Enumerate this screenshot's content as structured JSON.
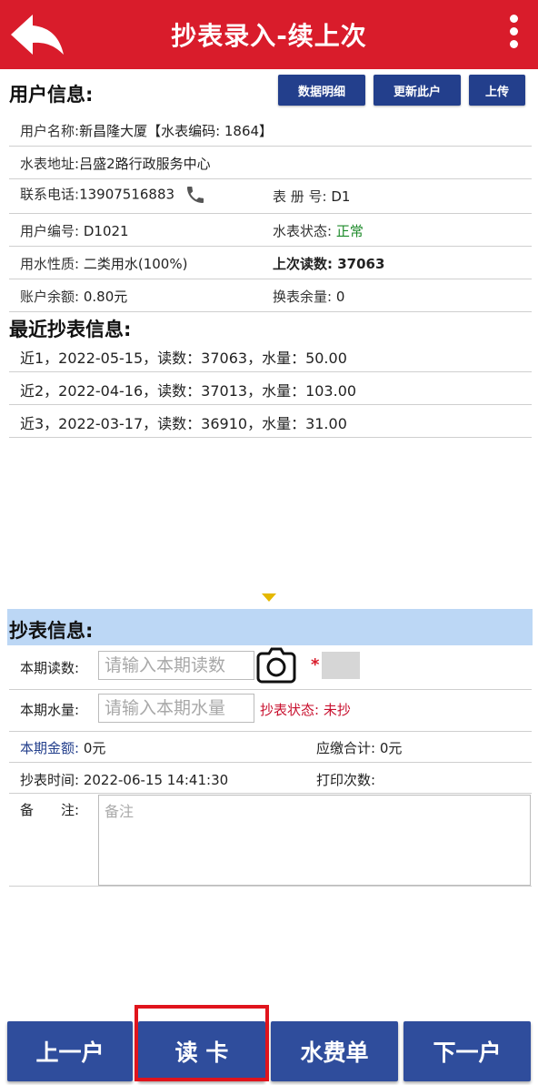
{
  "header": {
    "title": "抄表录入-续上次"
  },
  "user_section": {
    "title": "用户信息:",
    "buttons": {
      "detail": "数据明细",
      "update": "更新此户",
      "upload": "上传"
    },
    "name_label": "用户名称:",
    "name_value": "新昌隆大厦【水表编码: 1864】",
    "address_label": "水表地址:",
    "address_value": "吕盛2路行政服务中心",
    "phone_label": "联系电话:",
    "phone_value": "13907516883",
    "book_label": "表 册 号:",
    "book_value": "D1",
    "user_no_label": "用户编号:",
    "user_no_value": "D1021",
    "meter_status_label": "水表状态:",
    "meter_status_value": "正常",
    "water_type_label": "用水性质:",
    "water_type_value": "二类用水(100%)",
    "last_reading_label": "上次读数:",
    "last_reading_value": "37063",
    "balance_label": "账户余额:",
    "balance_value": "0.80元",
    "swap_label": "换表余量:",
    "swap_value": "0"
  },
  "recent_section": {
    "title": "最近抄表信息:",
    "records": [
      "近1，2022-05-15，读数：37063，水量：50.00",
      "近2，2022-04-16，读数：37013，水量：103.00",
      "近3，2022-03-17，读数：36910，水量：31.00"
    ]
  },
  "reading_section": {
    "title": "抄表信息:",
    "current_reading_label": "本期读数:",
    "current_reading_placeholder": "请输入本期读数",
    "current_volume_label": "本期水量:",
    "current_volume_placeholder": "请输入本期水量",
    "read_status_label": "抄表状态:",
    "read_status_value": "未抄",
    "amount_label": "本期金额:",
    "amount_value": "0元",
    "total_due_label": "应缴合计:",
    "total_due_value": "0元",
    "read_time_label": "抄表时间:",
    "read_time_value": "2022-06-15 14:41:30",
    "print_count_label": "打印次数:",
    "memo_label": "备　　注:",
    "memo_placeholder": "备注"
  },
  "bottom_bar": {
    "prev": "上一户",
    "read_card": "读 卡",
    "bill": "水费单",
    "next": "下一户"
  },
  "colors": {
    "header": "#d91c2b",
    "button": "#2f4d9c",
    "band": "#bcd7f5",
    "highlight": "#e0141c"
  }
}
